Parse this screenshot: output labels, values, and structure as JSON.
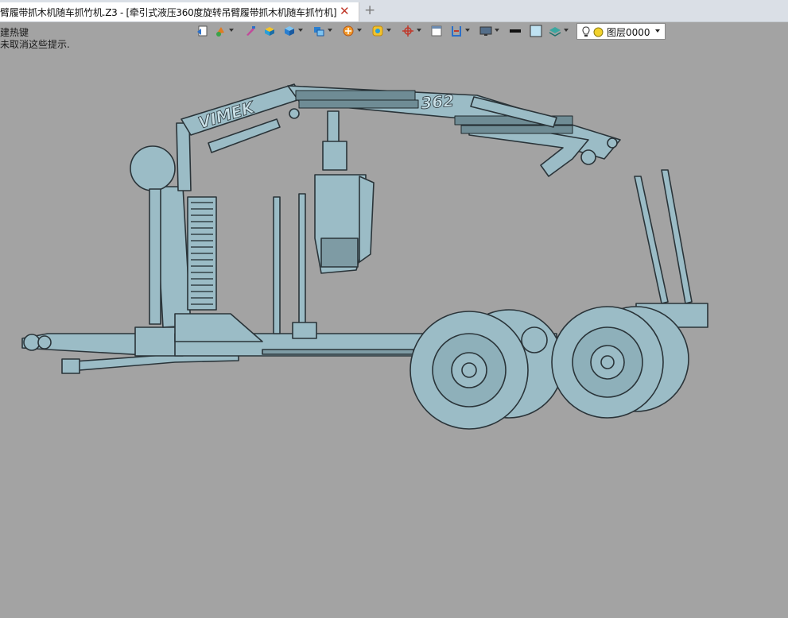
{
  "tab": {
    "title": "臂履带抓木机随车抓竹机.Z3 - [牵引式液压360度旋转吊臂履带抓木机随车抓竹机]",
    "close_glyph": "✕",
    "add_glyph": "+"
  },
  "hints": {
    "line1": "建热键",
    "line2": "未取消这些提示."
  },
  "toolbar": {
    "icons": [
      "undo-icon",
      "paint-icon",
      "brush-icon",
      "cube-yellow-icon",
      "cube-blue-icon",
      "cube-stack-icon",
      "texture-icon",
      "shape-icon",
      "axis-icon",
      "window-icon",
      "section-icon",
      "display-icon",
      "line-style-icon",
      "fill-color-icon",
      "layer-stack-icon"
    ]
  },
  "layer": {
    "name": "图层0000"
  },
  "viewport": {
    "model_text_brand": "VIMEK",
    "model_text_number": "362",
    "model_color": "#9bbcc6"
  }
}
